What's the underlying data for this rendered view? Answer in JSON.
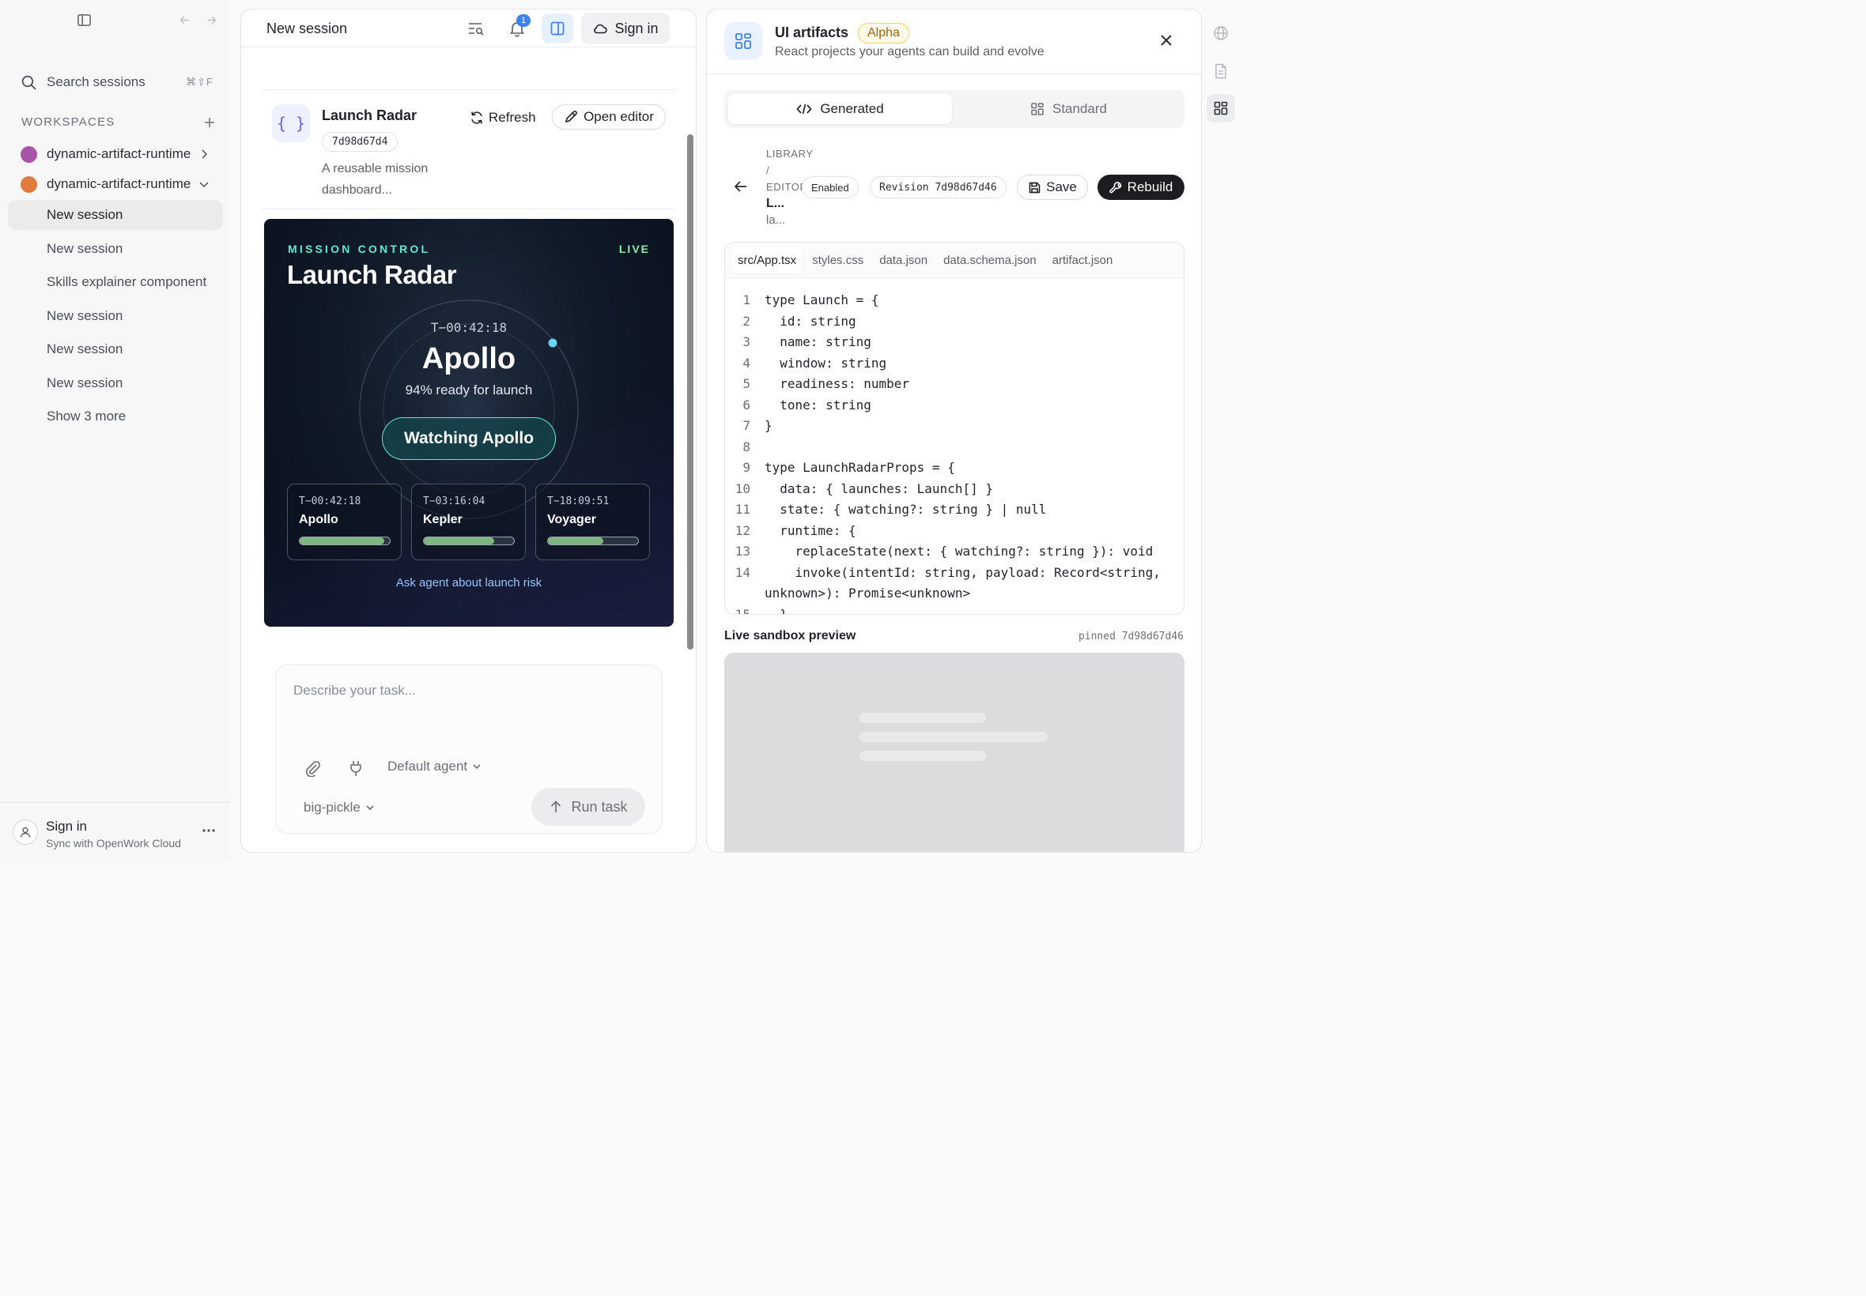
{
  "sidebar": {
    "search": {
      "placeholder": "Search sessions",
      "shortcut": "⌘⇧F"
    },
    "workspaces_label": "WORKSPACES",
    "workspaces": [
      {
        "name": "dynamic-artifact-runtime",
        "color": "#a855a8",
        "expanded": false
      },
      {
        "name": "dynamic-artifact-runtime",
        "color": "#e07b3c",
        "expanded": true
      }
    ],
    "sessions": [
      {
        "label": "New session",
        "active": true
      },
      {
        "label": "New session",
        "active": false
      },
      {
        "label": "Skills explainer component",
        "active": false
      },
      {
        "label": "New session",
        "active": false
      },
      {
        "label": "New session",
        "active": false
      },
      {
        "label": "New session",
        "active": false
      }
    ],
    "show_more": "Show 3 more",
    "footer": {
      "title": "Sign in",
      "subtitle": "Sync with OpenWork Cloud"
    }
  },
  "session": {
    "title": "New session",
    "notifications": "1",
    "sign_in": "Sign in",
    "artifact": {
      "title": "Launch Radar",
      "hash": "7d98d67d4",
      "description": "A reusable mission dashboard...",
      "refresh": "Refresh",
      "open_editor": "Open editor"
    },
    "preview": {
      "kicker": "MISSION CONTROL",
      "live": "LIVE",
      "title": "Launch Radar",
      "countdown": "T−00:42:18",
      "name": "Apollo",
      "readiness": "94% ready for launch",
      "watch_button": "Watching Apollo",
      "launches": [
        {
          "countdown": "T−00:42:18",
          "name": "Apollo",
          "readiness": 0.94
        },
        {
          "countdown": "T−03:16:04",
          "name": "Kepler",
          "readiness": 0.78
        },
        {
          "countdown": "T−18:09:51",
          "name": "Voyager",
          "readiness": 0.61
        }
      ],
      "ask_link": "Ask agent about launch risk"
    },
    "composer": {
      "placeholder": "Describe your task...",
      "agent": "Default agent",
      "model": "big-pickle",
      "run": "Run task"
    }
  },
  "artifacts_panel": {
    "title": "UI artifacts",
    "badge": "Alpha",
    "subtitle": "React projects your agents can build and evolve",
    "tabs": [
      "Generated",
      "Standard"
    ],
    "breadcrumb": {
      "library": "LIBRARY",
      "sep": "/",
      "editor": "EDITOR",
      "name": "L...",
      "desc": "la..."
    },
    "enabled": "Enabled",
    "revision": "Revision 7d98d67d46",
    "save": "Save",
    "rebuild": "Rebuild",
    "files": [
      "src/App.tsx",
      "styles.css",
      "data.json",
      "data.schema.json",
      "artifact.json"
    ],
    "code": [
      {
        "n": "1",
        "t": "type Launch = {"
      },
      {
        "n": "2",
        "t": "  id: string"
      },
      {
        "n": "3",
        "t": "  name: string"
      },
      {
        "n": "4",
        "t": "  window: string"
      },
      {
        "n": "5",
        "t": "  readiness: number"
      },
      {
        "n": "6",
        "t": "  tone: string"
      },
      {
        "n": "7",
        "t": "}"
      },
      {
        "n": "8",
        "t": ""
      },
      {
        "n": "9",
        "t": "type LaunchRadarProps = {"
      },
      {
        "n": "10",
        "t": "  data: { launches: Launch[] }"
      },
      {
        "n": "11",
        "t": "  state: { watching?: string } | null"
      },
      {
        "n": "12",
        "t": "  runtime: {"
      },
      {
        "n": "13",
        "t": "    replaceState(next: { watching?: string }): void"
      },
      {
        "n": "14",
        "t": "    invoke(intentId: string, payload: Record<string,"
      },
      {
        "n": "",
        "t": "unknown>): Promise<unknown>"
      },
      {
        "n": "15",
        "t": "  }"
      }
    ],
    "sandbox_label": "Live sandbox preview",
    "sandbox_pin": "pinned 7d98d67d46"
  }
}
